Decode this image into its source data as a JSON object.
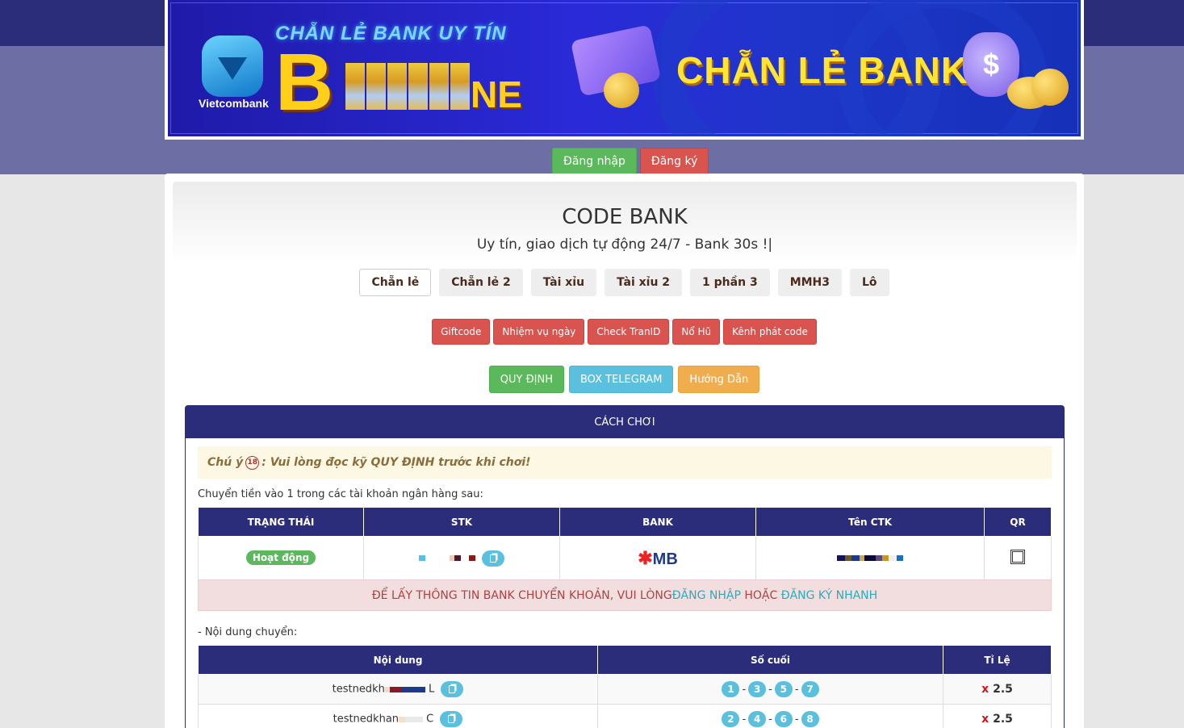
{
  "banner": {
    "bank_name": "Vietcombank",
    "tagline": "CHẴN LẺ BANK UY TÍN",
    "brand_initial": "B",
    "brand_tail": "NE",
    "headline": "CHẴN LẺ BANK",
    "bag_symbol": "$"
  },
  "auth": {
    "login": "Đăng nhập",
    "register": "Đăng ký"
  },
  "hero": {
    "title": "CODE BANK",
    "subtitle": "Uy tín, giao dịch tự động 24/7 - Bank 30s !|"
  },
  "tabs": [
    {
      "label": "Chẵn lẻ",
      "active": true
    },
    {
      "label": "Chẵn lẻ 2",
      "active": false
    },
    {
      "label": "Tài xỉu",
      "active": false
    },
    {
      "label": "Tài xỉu 2",
      "active": false
    },
    {
      "label": "1 phần 3",
      "active": false
    },
    {
      "label": "MMH3",
      "active": false
    },
    {
      "label": "Lô",
      "active": false
    }
  ],
  "features": [
    "Giftcode",
    "Nhiệm vụ ngày",
    "Check TranID",
    "Nổ Hũ",
    "Kênh phát code"
  ],
  "actions": {
    "rules": "QUY ĐỊNH",
    "telegram": "BOX TELEGRAM",
    "guide": "Hướng Dẫn"
  },
  "howto": {
    "header": "CÁCH CHƠI",
    "alert_prefix": "Chú ý",
    "alert_age": "18",
    "alert_text": ": Vui lòng đọc kỹ QUY ĐỊNH trước khi chơi!",
    "transfer_note": "Chuyển tiền vào 1 trong các tài khoản ngân hàng sau:",
    "bank_table": {
      "headers": [
        "TRẠNG THÁI",
        "STK",
        "BANK",
        "Tên CTK",
        "QR"
      ],
      "row": {
        "status": "Hoạt động",
        "bank": "MB"
      }
    },
    "warn": {
      "text1": "ĐỂ LẤY THÔNG TIN BANK CHUYỂN KHOẢN, VUI LÒNG ",
      "link1": "ĐĂNG NHẬP",
      "text2": " HOẶC ",
      "link2": "ĐĂNG KÝ NHANH"
    },
    "content_note": "- Nội dung chuyển:",
    "content_table": {
      "headers": [
        "Nội dung",
        "Số cuối",
        "Tỉ Lệ"
      ],
      "rows": [
        {
          "content_prefix": "testnedkh",
          "content_suffix": "L",
          "digits": [
            "1",
            "3",
            "5",
            "7"
          ],
          "rate_x": "x",
          "rate": "2.5"
        },
        {
          "content_prefix": "testnedkhan",
          "content_suffix": "C",
          "digits": [
            "2",
            "4",
            "6",
            "8"
          ],
          "rate_x": "x",
          "rate": "2.5"
        }
      ]
    }
  },
  "colors": {
    "navy": "#2b2d7a",
    "green": "#5cb85c",
    "red": "#d9534f",
    "info": "#5bc0de",
    "warning": "#f0ad4e"
  }
}
